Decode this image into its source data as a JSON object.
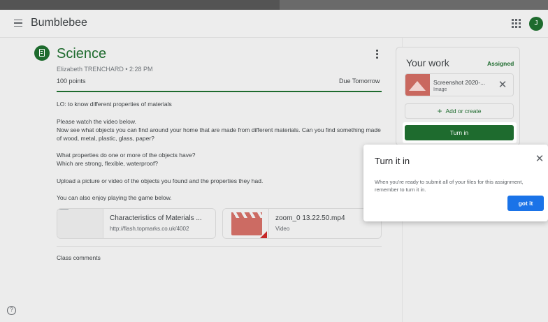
{
  "app": {
    "title": "Bumblebee",
    "avatar_initial": "J"
  },
  "assignment": {
    "title": "Science",
    "meta": "Elizabeth TRENCHARD • 2:28 PM",
    "points": "100 points",
    "due": "Due Tomorrow",
    "paragraphs": [
      "LO: to know different properties of materials",
      "Please watch the video below.\nNow see what objects you can find around your home that are made from different materials. Can you find something made of wood, metal, plastic, glass, paper?",
      "What properties do one or more of the objects have?\nWhich are strong, flexible, waterproof?",
      "Upload a picture or video of the objects you found and the properties they had.",
      "You can also enjoy playing the game below."
    ],
    "attachments": [
      {
        "title": "Characteristics of Materials ...",
        "subtitle": "http://flash.topmarks.co.uk/4002"
      },
      {
        "title": "zoom_0 13.22.50.mp4",
        "subtitle": "Video"
      }
    ],
    "class_comments": "Class comments"
  },
  "your_work": {
    "title": "Your work",
    "status": "Assigned",
    "file": {
      "name": "Screenshot 2020-...",
      "type": "Image"
    },
    "add_create": "Add or create",
    "turn_in": "Turn in"
  },
  "popup": {
    "title": "Turn it in",
    "body": "When you're ready to submit all of your files for this assignment, remember to turn it in.",
    "button": "got it"
  },
  "icons": {
    "menu": "hamburger-menu-icon",
    "apps": "apps-grid-icon",
    "assignment": "assignment-icon",
    "more": "more-vert-icon",
    "close": "close-icon",
    "help": "help-icon"
  },
  "colors": {
    "primary_green": "#1e6b2e",
    "accent_blue": "#1a73e8",
    "thumb_red": "#c9685f"
  }
}
